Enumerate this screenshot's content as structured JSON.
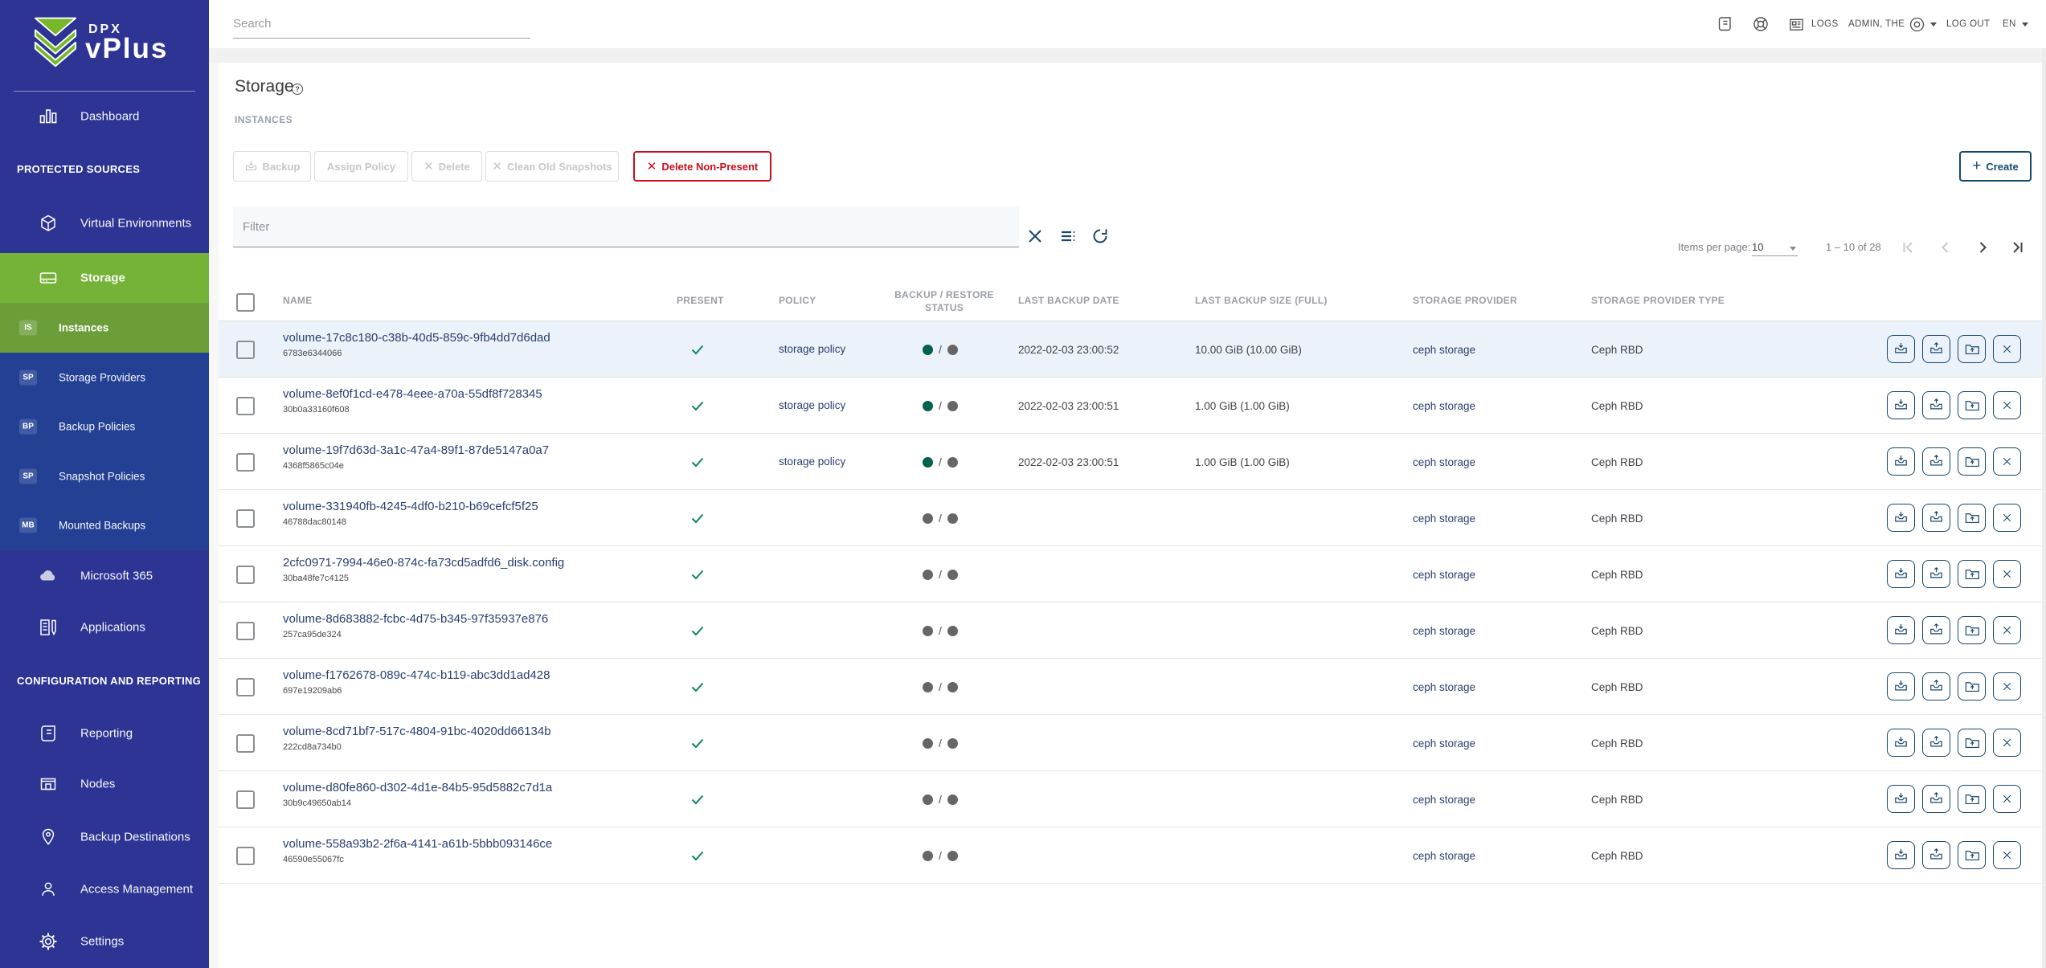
{
  "colors": {
    "status_green": "#00624c",
    "status_gray": "#666666",
    "accent_green": "#75b238",
    "red": "#c7101c",
    "navy": "#14496e",
    "link": "#2a3f6e"
  },
  "sidebar": {
    "logo_line1": "DPX",
    "logo_line2": "vPlus",
    "dashboard": "Dashboard",
    "section_protected": "PROTECTED SOURCES",
    "virtual_environments": "Virtual Environments",
    "storage": "Storage",
    "instances": {
      "badge": "IS",
      "label": "Instances"
    },
    "storage_providers": {
      "badge": "SP",
      "label": "Storage Providers"
    },
    "backup_policies": {
      "badge": "BP",
      "label": "Backup Policies"
    },
    "snapshot_policies": {
      "badge": "SP",
      "label": "Snapshot Policies"
    },
    "mounted_backups": {
      "badge": "MB",
      "label": "Mounted Backups"
    },
    "microsoft365": "Microsoft 365",
    "applications": "Applications",
    "section_config": "CONFIGURATION AND REPORTING",
    "reporting": "Reporting",
    "nodes": "Nodes",
    "backup_destinations": "Backup Destinations",
    "access_management": "Access Management",
    "settings": "Settings"
  },
  "topbar": {
    "search_placeholder": "Search",
    "logs": "LOGS",
    "user": "ADMIN, THE",
    "logout": "LOG OUT",
    "lang": "EN"
  },
  "page": {
    "title": "Storage",
    "subtitle": "INSTANCES"
  },
  "toolbar": {
    "backup": "Backup",
    "assign_policy": "Assign Policy",
    "delete": "Delete",
    "clean_old_snapshots": "Clean Old Snapshots",
    "delete_non_present": "Delete Non-Present",
    "create": "Create"
  },
  "filter": {
    "placeholder": "Filter"
  },
  "pagination": {
    "items_per_page_label": "Items per page:",
    "page_size": "10",
    "range": "1 – 10 of 28"
  },
  "table": {
    "columns": [
      "NAME",
      "PRESENT",
      "POLICY",
      "BACKUP / RESTORE STATUS",
      "LAST BACKUP DATE",
      "LAST BACKUP SIZE (FULL)",
      "STORAGE PROVIDER",
      "STORAGE PROVIDER TYPE"
    ],
    "rows": [
      {
        "name": "volume-17c8c180-c38b-40d5-859c-9fb4dd7d6dad",
        "id": "6783e6344066",
        "present": true,
        "policy": "storage policy",
        "backup_status": "green",
        "restore_status": "gray",
        "last_backup_date": "2022-02-03 23:00:52",
        "last_backup_size": "10.00 GiB (10.00 GiB)",
        "provider": "ceph storage",
        "provider_type": "Ceph RBD",
        "highlighted": true
      },
      {
        "name": "volume-8ef0f1cd-e478-4eee-a70a-55df8f728345",
        "id": "30b0a33160f608",
        "present": true,
        "policy": "storage policy",
        "backup_status": "green",
        "restore_status": "gray",
        "last_backup_date": "2022-02-03 23:00:51",
        "last_backup_size": "1.00 GiB (1.00 GiB)",
        "provider": "ceph storage",
        "provider_type": "Ceph RBD",
        "highlighted": false
      },
      {
        "name": "volume-19f7d63d-3a1c-47a4-89f1-87de5147a0a7",
        "id": "4368f5865c04e",
        "present": true,
        "policy": "storage policy",
        "backup_status": "green",
        "restore_status": "gray",
        "last_backup_date": "2022-02-03 23:00:51",
        "last_backup_size": "1.00 GiB (1.00 GiB)",
        "provider": "ceph storage",
        "provider_type": "Ceph RBD",
        "highlighted": false
      },
      {
        "name": "volume-331940fb-4245-4df0-b210-b69cefcf5f25",
        "id": "46788dac80148",
        "present": true,
        "policy": "",
        "backup_status": "gray",
        "restore_status": "gray",
        "last_backup_date": "",
        "last_backup_size": "",
        "provider": "ceph storage",
        "provider_type": "Ceph RBD",
        "highlighted": false
      },
      {
        "name": "2cfc0971-7994-46e0-874c-fa73cd5adfd6_disk.config",
        "id": "30ba48fe7c4125",
        "present": true,
        "policy": "",
        "backup_status": "gray",
        "restore_status": "gray",
        "last_backup_date": "",
        "last_backup_size": "",
        "provider": "ceph storage",
        "provider_type": "Ceph RBD",
        "highlighted": false
      },
      {
        "name": "volume-8d683882-fcbc-4d75-b345-97f35937e876",
        "id": "257ca95de324",
        "present": true,
        "policy": "",
        "backup_status": "gray",
        "restore_status": "gray",
        "last_backup_date": "",
        "last_backup_size": "",
        "provider": "ceph storage",
        "provider_type": "Ceph RBD",
        "highlighted": false
      },
      {
        "name": "volume-f1762678-089c-474c-b119-abc3dd1ad428",
        "id": "697e19209ab6",
        "present": true,
        "policy": "",
        "backup_status": "gray",
        "restore_status": "gray",
        "last_backup_date": "",
        "last_backup_size": "",
        "provider": "ceph storage",
        "provider_type": "Ceph RBD",
        "highlighted": false
      },
      {
        "name": "volume-8cd71bf7-517c-4804-91bc-4020dd66134b",
        "id": "222cd8a734b0",
        "present": true,
        "policy": "",
        "backup_status": "gray",
        "restore_status": "gray",
        "last_backup_date": "",
        "last_backup_size": "",
        "provider": "ceph storage",
        "provider_type": "Ceph RBD",
        "highlighted": false
      },
      {
        "name": "volume-d80fe860-d302-4d1e-84b5-95d5882c7d1a",
        "id": "30b9c49650ab14",
        "present": true,
        "policy": "",
        "backup_status": "gray",
        "restore_status": "gray",
        "last_backup_date": "",
        "last_backup_size": "",
        "provider": "ceph storage",
        "provider_type": "Ceph RBD",
        "highlighted": false
      },
      {
        "name": "volume-558a93b2-2f6a-4141-a61b-5bbb093146ce",
        "id": "46590e55067fc",
        "present": true,
        "policy": "",
        "backup_status": "gray",
        "restore_status": "gray",
        "last_backup_date": "",
        "last_backup_size": "",
        "provider": "ceph storage",
        "provider_type": "Ceph RBD",
        "highlighted": false
      }
    ]
  }
}
